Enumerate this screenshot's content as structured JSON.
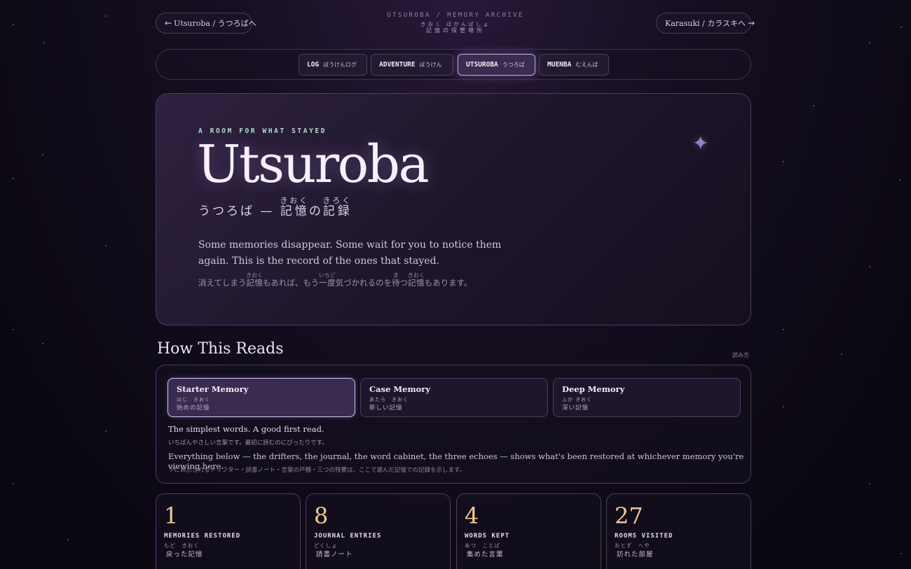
{
  "topbar": {
    "back_label": "Utsuroba / うつろばへ",
    "back_arrow": "←",
    "archive_title": "UTSUROBA / MEMORY ARCHIVE",
    "archive_ruby": "きおく ほかんばしょ",
    "archive_jp": "記憶の保管場所",
    "forward_label": "Karasuki / カラスキへ",
    "forward_arrow": "→"
  },
  "nav": {
    "tabs": [
      {
        "en": "LOG",
        "jp": "ぼうけんログ",
        "active": false
      },
      {
        "en": "ADVENTURE",
        "jp": "ぼうけん",
        "active": false
      },
      {
        "en": "UTSUROBA",
        "jp": "うつろば",
        "active": true
      },
      {
        "en": "MUENBA",
        "jp": "むえんば",
        "active": false
      }
    ]
  },
  "hero": {
    "eyebrow": "A ROOM FOR WHAT STAYED",
    "title": "Utsuroba",
    "subtitle_prefix": "うつろば — ",
    "subtitle_word1": "記憶",
    "subtitle_word1_ruby": "きおく",
    "subtitle_mid": "の",
    "subtitle_word2": "記録",
    "subtitle_word2_ruby": "きろく",
    "description": "Some memories disappear. Some wait for you to notice them again. This is the record of the ones that stayed.",
    "description_jp_1": "消えてしまう",
    "description_jp_word1": "記憶",
    "description_jp_word1_ruby": "きおく",
    "description_jp_2": "もあれば、もう",
    "description_jp_word2": "一度",
    "description_jp_word2_ruby": "いちど",
    "description_jp_3": "気づかれるのを",
    "description_jp_word3": "待",
    "description_jp_word3_ruby": "ま",
    "description_jp_4": "つ",
    "description_jp_word4": "記憶",
    "description_jp_word4_ruby": "きおく",
    "description_jp_5": "もあります。",
    "sparkle": "✦"
  },
  "reading": {
    "title": "How This Reads",
    "title_jp": "読み方",
    "modes": [
      {
        "name": "Starter Memory",
        "ruby": "はじ　きおく",
        "jp": "始めの記憶",
        "active": true
      },
      {
        "name": "Case Memory",
        "ruby": "あたら　きおく",
        "jp": "新しい記憶",
        "active": false
      },
      {
        "name": "Deep Memory",
        "ruby": "ふか きおく",
        "jp": "深い記憶",
        "active": false
      }
    ],
    "line1": "The simplest words. A good first read.",
    "line1_jp": "いちばんやさしい言葉です。最初に読むのにぴったりです。",
    "line2": "Everything below — the drifters, the journal, the word cabinet, the three echoes — shows what's been restored at whichever memory you're viewing here.",
    "line2_jp": "下に表示されるドリフター・読書ノート・言葉の戸棚・三つの残響は、ここで選んだ記憶での記録を示します。"
  },
  "stats": [
    {
      "value": "1",
      "label": "MEMORIES RESTORED",
      "ruby": "もど　きおく",
      "jp": "戻った記憶"
    },
    {
      "value": "8",
      "label": "JOURNAL ENTRIES",
      "ruby": "どくしょ",
      "jp": "読書ノート"
    },
    {
      "value": "4",
      "label": "WORDS KEPT",
      "ruby": "あつ　ことば",
      "jp": "集めた言葉"
    },
    {
      "value": "27",
      "label": "ROOMS VISITED",
      "ruby": "おとず　へや",
      "jp": "訪れた部屋"
    }
  ],
  "colors": {
    "accent_gold": "#f2c891",
    "accent_mint": "#a8e0c8",
    "active_border": "#bfa9e0",
    "background": "#0d0914"
  }
}
